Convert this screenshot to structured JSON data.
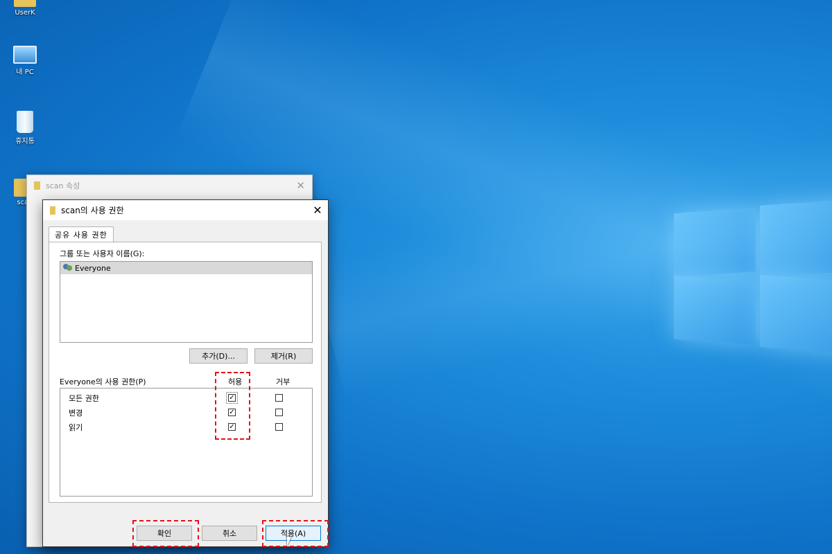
{
  "desktop": {
    "icons": [
      {
        "label": "UserK"
      },
      {
        "label": "내 PC"
      },
      {
        "label": "휴지통"
      },
      {
        "label": "scan"
      }
    ]
  },
  "back_window": {
    "title": "scan 속성",
    "close_glyph": "✕"
  },
  "dialog": {
    "title": "scan의 사용 권한",
    "close_glyph": "✕",
    "tab_label": "공유 사용 권한",
    "group_label": "그룹 또는 사용자 이름(G):",
    "users": [
      {
        "name": "Everyone"
      }
    ],
    "add_button": "추가(D)...",
    "remove_button": "제거(R)",
    "perm_label": "Everyone의 사용 권한(P)",
    "allow_header": "허용",
    "deny_header": "거부",
    "permissions": [
      {
        "name": "모든 권한",
        "allow": true,
        "deny": false
      },
      {
        "name": "변경",
        "allow": true,
        "deny": false
      },
      {
        "name": "읽기",
        "allow": true,
        "deny": false
      }
    ],
    "ok_button": "확인",
    "cancel_button": "취소",
    "apply_button": "적용(A)"
  },
  "check_glyph": "✓",
  "highlight_color": "#e5101a"
}
